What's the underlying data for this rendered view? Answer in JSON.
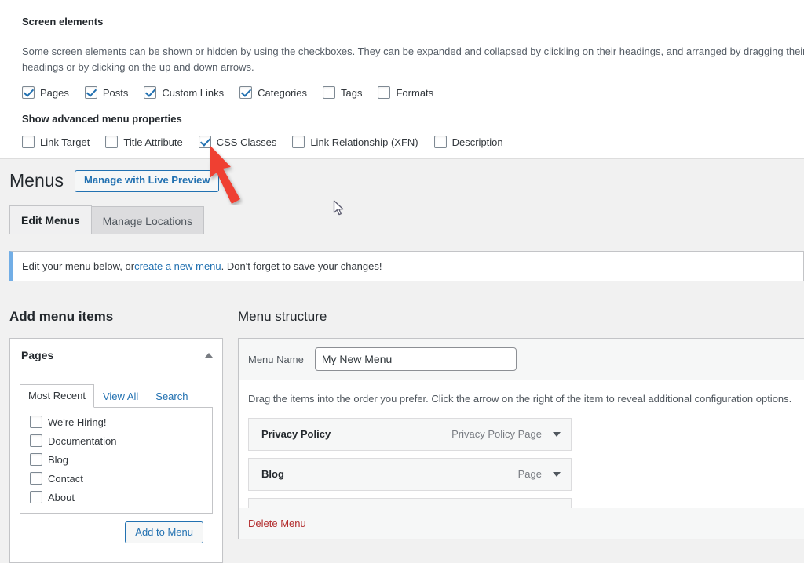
{
  "screen_options": {
    "heading": "Screen elements",
    "description": "Some screen elements can be shown or hidden by using the checkboxes. They can be expanded and collapsed by clickling on their headings, and arranged by dragging their headings or by clicking on the up and down arrows.",
    "element_checkboxes": [
      {
        "label": "Pages",
        "checked": true
      },
      {
        "label": "Posts",
        "checked": true
      },
      {
        "label": "Custom Links",
        "checked": true
      },
      {
        "label": "Categories",
        "checked": true
      },
      {
        "label": "Tags",
        "checked": false
      },
      {
        "label": "Formats",
        "checked": false
      }
    ],
    "advanced_heading": "Show advanced menu properties",
    "advanced_checkboxes": [
      {
        "label": "Link Target",
        "checked": false
      },
      {
        "label": "Title Attribute",
        "checked": false
      },
      {
        "label": "CSS Classes",
        "checked": true
      },
      {
        "label": "Link Relationship (XFN)",
        "checked": false
      },
      {
        "label": "Description",
        "checked": false
      }
    ]
  },
  "header": {
    "title": "Menus",
    "live_preview_button": "Manage with Live Preview"
  },
  "tabs": [
    {
      "label": "Edit Menus",
      "active": true
    },
    {
      "label": "Manage Locations",
      "active": false
    }
  ],
  "notice": {
    "text_before": "Edit your menu below, or ",
    "link": "create a new menu",
    "text_after": ". Don't forget to save your changes!"
  },
  "add_menu_items": {
    "heading": "Add menu items",
    "pages_panel": {
      "title": "Pages",
      "collapse_icon": "chevron-up-icon",
      "tabs": [
        {
          "label": "Most Recent",
          "active": true
        },
        {
          "label": "View All",
          "active": false
        },
        {
          "label": "Search",
          "active": false
        }
      ],
      "items": [
        {
          "label": "We're Hiring!",
          "checked": false
        },
        {
          "label": "Documentation",
          "checked": false
        },
        {
          "label": "Blog",
          "checked": false
        },
        {
          "label": "Contact",
          "checked": false
        },
        {
          "label": "About",
          "checked": false
        }
      ],
      "add_button": "Add to Menu"
    }
  },
  "menu_structure": {
    "heading": "Menu structure",
    "menu_name_label": "Menu Name",
    "menu_name_value": "My New Menu",
    "drag_instructions": "Drag the items into the order you prefer. Click the arrow on the right of the item to reveal additional configuration options.",
    "items": [
      {
        "title": "Privacy Policy",
        "type": "Privacy Policy Page",
        "toggle_icon": "chevron-down-icon"
      },
      {
        "title": "Blog",
        "type": "Page",
        "toggle_icon": "chevron-down-icon"
      },
      {
        "title": "",
        "type": "",
        "toggle_icon": "chevron-down-icon"
      }
    ],
    "delete_menu_link": "Delete Menu"
  },
  "annotations": {
    "arrow_color": "#ef3f33",
    "arrow_target": "CSS Classes checkbox",
    "cursor": "arrow-pointer"
  },
  "colors": {
    "accent_blue": "#2271b1",
    "page_bg": "#f1f1f1",
    "panel_bg": "#ffffff",
    "border": "#c3c4c7",
    "danger_red": "#b32d2e"
  }
}
